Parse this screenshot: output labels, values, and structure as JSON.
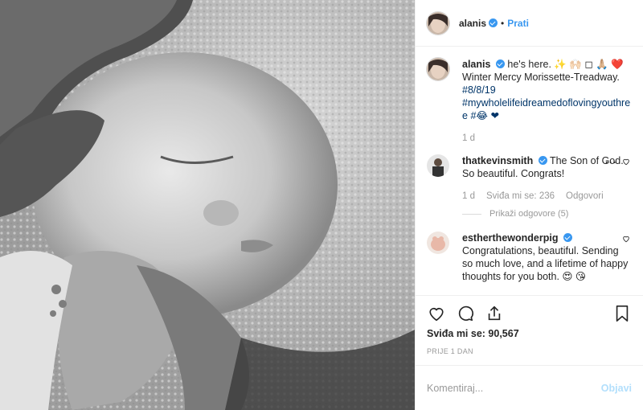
{
  "header": {
    "username": "alanis",
    "follow_label": "Prati"
  },
  "caption": {
    "username": "alanis",
    "text": "he's here. ✨ 🙌🏻 ◻ 🙏🏼 ❤️ Winter Mercy Morissette-Treadway.",
    "tag1": "#8/8/19",
    "tag2": "#mywholelifeidreamedoflovingyouthree",
    "emoji_tail": "#😂 ❤",
    "time": "1 d"
  },
  "comments": [
    {
      "username": "thatkevinsmith",
      "text": "The Son of God. So beautiful. Congrats!",
      "time": "1 d",
      "likes": "Sviđa mi se: 236",
      "reply_label": "Odgovori",
      "view_replies": "Prikaži odgovore (5)"
    },
    {
      "username": "estherthewonderpig",
      "text": "Congratulations, beautiful. Sending so much love, and a lifetime of happy thoughts for you both. 😍 😘"
    }
  ],
  "actions": {
    "likes": "Sviđa mi se: 90,567",
    "posted": "PRIJE 1 DAN"
  },
  "add_comment": {
    "placeholder": "Komentiraj...",
    "post_label": "Objavi"
  },
  "icons": [
    "heart-icon",
    "comment-icon",
    "share-icon",
    "bookmark-icon",
    "verified-badge-icon",
    "more-icon"
  ],
  "colors": {
    "link": "#3897f0",
    "hashtag": "#003569",
    "muted": "#999999",
    "post_disabled": "#b2dffc"
  }
}
